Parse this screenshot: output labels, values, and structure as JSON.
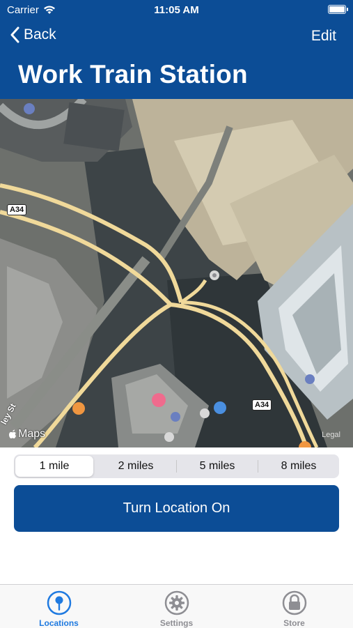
{
  "status_bar": {
    "carrier": "Carrier",
    "time": "11:05 AM"
  },
  "nav": {
    "back_label": "Back",
    "edit_label": "Edit"
  },
  "page": {
    "title": "Work Train Station"
  },
  "map": {
    "road_labels": [
      "A34",
      "A34"
    ],
    "street_label": "ley St",
    "attribution": "Maps",
    "legal": "Legal"
  },
  "radius_selector": {
    "options": [
      "1 mile",
      "2 miles",
      "5 miles",
      "8 miles"
    ],
    "selected": "1 mile"
  },
  "primary_action": {
    "label": "Turn Location On"
  },
  "tabbar": {
    "items": [
      {
        "label": "Locations",
        "icon": "location-pin-icon",
        "active": true
      },
      {
        "label": "Settings",
        "icon": "gear-icon",
        "active": false
      },
      {
        "label": "Store",
        "icon": "lock-icon",
        "active": false
      }
    ]
  },
  "colors": {
    "header_bg": "#0c4d96",
    "accent": "#1f7ae0",
    "road": "#f0d99a"
  }
}
